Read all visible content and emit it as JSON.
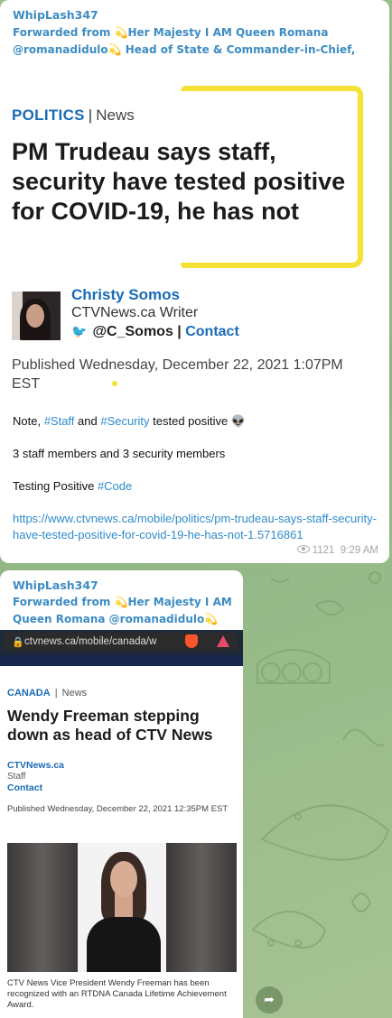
{
  "colors": {
    "accent": "#3d8cc3",
    "background": "#9fbf8c",
    "highlight": "#f4e236",
    "ctv_blue": "#1a6bb5"
  },
  "messages": [
    {
      "sender": "WhipLash347",
      "forwarded_line1": "Forwarded from 💫Her Majesty I AM Queen Romana @romanadidulo💫 Head of State & Commander-in-Chief, Head of Gov't, Q...",
      "article": {
        "section": "POLITICS",
        "section_sub": "News",
        "headline": "PM Trudeau says staff, security have tested positive for COVID-19, he has not",
        "author": "Christy Somos",
        "author_role": "CTVNews.ca Writer",
        "twitter_handle": "@C_Somos",
        "contact_label": "Contact",
        "published": "Published Wednesday, December 22, 2021 1:07PM EST"
      },
      "text": {
        "line1_pre": "Note, ",
        "line1_tag1": "#Staff",
        "line1_mid": " and ",
        "line1_tag2": "#Security",
        "line1_post": " tested positive 👽",
        "line2": "3 staff members and 3 security members",
        "line3_pre": " Testing Positive ",
        "line3_tag": "#Code",
        "link": "https://www.ctvnews.ca/mobile/politics/pm-trudeau-says-staff-security-have-tested-positive-for-covid-19-he-has-not-1.5716861"
      },
      "views": "1121",
      "time": "9:29 AM"
    },
    {
      "sender": "WhipLash347",
      "forwarded": "Forwarded from 💫Her Majesty I AM Queen Romana @romanadidulo💫 ...",
      "browser_url": "ctvnews.ca/mobile/canada/w",
      "article": {
        "section": "CANADA",
        "section_sub": "News",
        "headline": "Wendy Freeman stepping down as head of CTV News",
        "source": "CTVNews.ca",
        "role": "Staff",
        "contact_label": "Contact",
        "published": "Published Wednesday, December 22, 2021 12:35PM EST",
        "caption": "CTV News Vice President Wendy Freeman has been recognized with an RTDNA Canada Lifetime Achievement Award."
      }
    }
  ],
  "icons": {
    "share": "share-arrow-icon",
    "views": "eye-icon",
    "twitter": "twitter-icon",
    "lock": "lock-icon"
  }
}
